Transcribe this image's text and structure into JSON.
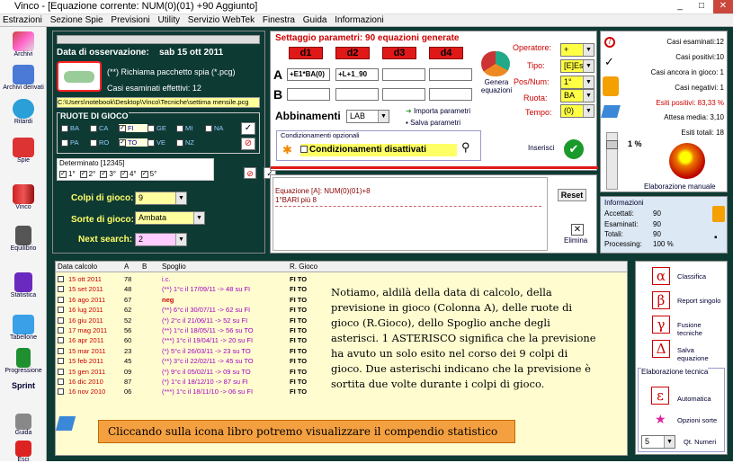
{
  "window": {
    "title": "Vinco - [Equazione corrente: NUM(0)(01) +90 Aggiunto]",
    "min": "_",
    "max": "□",
    "close": "✕"
  },
  "menu": [
    "Estrazioni",
    "Sezione Spie",
    "Previsioni",
    "Utility",
    "Servizio WebTek",
    "Finestra",
    "Guida",
    "Informazioni"
  ],
  "sidebar": [
    "Archivi",
    "Archivi derivati",
    "Ritardi",
    "Spie",
    "Vinco",
    "Equilibrio",
    "Statistica",
    "Tabellone",
    "Progressione",
    "Sprint",
    "Guida",
    "Esci"
  ],
  "obs": {
    "label": "Data di osservazione:",
    "date": "sab 15 ott 2011",
    "pkg": "(**) Richiama pacchetto spia (*.pcg)",
    "examined": "Casi esaminati effettivi: 12",
    "path": "C:\\Users\\notebook\\Desktop\\Vinco\\Tecniche\\settima mensile.pcg"
  },
  "wheels": {
    "title": "RUOTE DI GIOCO",
    "row1": [
      "BA",
      "CA",
      "FI",
      "GE",
      "MI",
      "NA"
    ],
    "row2": [
      "PA",
      "RO",
      "TO",
      "VE",
      "NZ"
    ]
  },
  "det": {
    "title": "Determinato [12345]",
    "items": [
      "1°",
      "2°",
      "3°",
      "4°",
      "5°"
    ]
  },
  "game": {
    "colpi_label": "Colpi di gioco:",
    "colpi": "9",
    "sorte_label": "Sorte di gioco:",
    "sorte": "Ambata",
    "next_label": "Next search:",
    "next": "2"
  },
  "params": {
    "title": "Settaggio parametri: 90 equazioni generate",
    "d": [
      "d1",
      "d2",
      "d3",
      "d4"
    ],
    "a_label": "A",
    "b_label": "B",
    "a1": "+E1*BA(0)",
    "a2": "+L+1_90",
    "generate": "Genera equazioni",
    "abb_label": "Abbinamenti",
    "abb": "LAB",
    "import": "Importa parametri",
    "save": "Salva parametri",
    "opt_title": "Condizionamenti opzionali",
    "opt": "Condizionamenti disattivati",
    "insert": "Inserisci"
  },
  "ops": {
    "operatore_l": "Operatore:",
    "operatore": "+",
    "tipo_l": "Tipo:",
    "tipo": "[E]Estr.",
    "pos_l": "Pos/Num:",
    "pos": "1°",
    "ruota_l": "Ruota:",
    "ruota": "BA",
    "tempo_l": "Tempo:",
    "tempo": "(0)"
  },
  "eq": {
    "line1": "Equazione [A]: NUM(0)(01)+8",
    "line2": "1°BARI  più 8",
    "reset": "Reset",
    "elimina": "Elimina"
  },
  "stats": {
    "casi_esaminati": "Casi esaminati:12",
    "casi_pos": "Casi positivi:10",
    "casi_gioco": "Casi ancora in gioco: 1",
    "casi_neg": "Casi negativi: 1",
    "esiti_pos": "Esiti positivi: 83,33 %",
    "attesa": "Attesa media: 3,10",
    "esiti_tot": "Esiti totali: 18",
    "pct": "1 %",
    "elab": "Elaborazione manuale"
  },
  "info": {
    "title": "Informazioni",
    "acc_l": "Accettati:",
    "acc": "90",
    "esa_l": "Esaminati:",
    "esa": "90",
    "tot_l": "Totali:",
    "tot": "90",
    "proc_l": "Processing:",
    "proc": "100 %"
  },
  "table": {
    "headers": [
      "Data calcolo",
      "A",
      "B",
      "Spoglio",
      "R. Gioco"
    ],
    "rows": [
      [
        "15 ott 2011",
        "78",
        "",
        "i.c.",
        "FI TO"
      ],
      [
        "15 set 2011",
        "48",
        "",
        "(**) 1°c il 17/09/11 -> 48 su FI",
        "FI TO"
      ],
      [
        "16 ago 2011",
        "67",
        "",
        "neg",
        "FI TO"
      ],
      [
        "16 lug 2011",
        "62",
        "",
        "(**) 6°c il 30/07/11 -> 62 su FI",
        "FI TO"
      ],
      [
        "16 giu 2011",
        "52",
        "",
        "(*) 2°c il 21/06/11 -> 52 su FI",
        "FI TO"
      ],
      [
        "17 mag 2011",
        "56",
        "",
        "(**) 1°c il 18/05/11 -> 56 su TO",
        "FI TO"
      ],
      [
        "16 apr 2011",
        "60",
        "",
        "(***) 1°c il 19/04/11 -> 20 su FI",
        "FI TO"
      ],
      [
        "15 mar 2011",
        "23",
        "",
        "(*) 5°c il 26/03/11 -> 23 su TO",
        "FI TO"
      ],
      [
        "15 feb 2011",
        "45",
        "",
        "(**) 3°c il 22/02/11 -> 45 su TO",
        "FI TO"
      ],
      [
        "15 gen 2011",
        "09",
        "",
        "(*) 9°c il 05/02/11 -> 09 su TO",
        "FI TO"
      ],
      [
        "16 dic 2010",
        "87",
        "",
        "(*) 1°c il 18/12/10 -> 87 su FI",
        "FI TO"
      ],
      [
        "16 nov 2010",
        "06",
        "",
        "(***) 1°c il 18/11/10 -> 06 su FI",
        "FI TO"
      ]
    ]
  },
  "note": "Notiamo, aldilà della data di calcolo, della previsione in gioco (Colonna A), delle ruote di gioco (R.Gioco), dello Spoglio anche degli asterisci. 1 ASTERISCO significa che la previsione ha avuto un solo esito nel corso dei 9 colpi di gioco. Due asterischi indicano che la previsione è sortita due volte durante i colpi di gioco.",
  "banner": "Cliccando sulla icona libro potremo visualizzare il compendio statistico",
  "right": {
    "classifica": "Classifica",
    "report": "Report singolo",
    "fusione": "Fusione tecniche",
    "salva": "Salva equazione",
    "elab_title": "Elaborazione tecnica",
    "automatica": "Automatica",
    "opzioni": "Opzioni sorte",
    "qt": "5",
    "qt_label": "Qt. Numeri",
    "alpha": "α",
    "beta": "β",
    "gamma": "γ",
    "delta": "Δ",
    "eps": "ε"
  }
}
